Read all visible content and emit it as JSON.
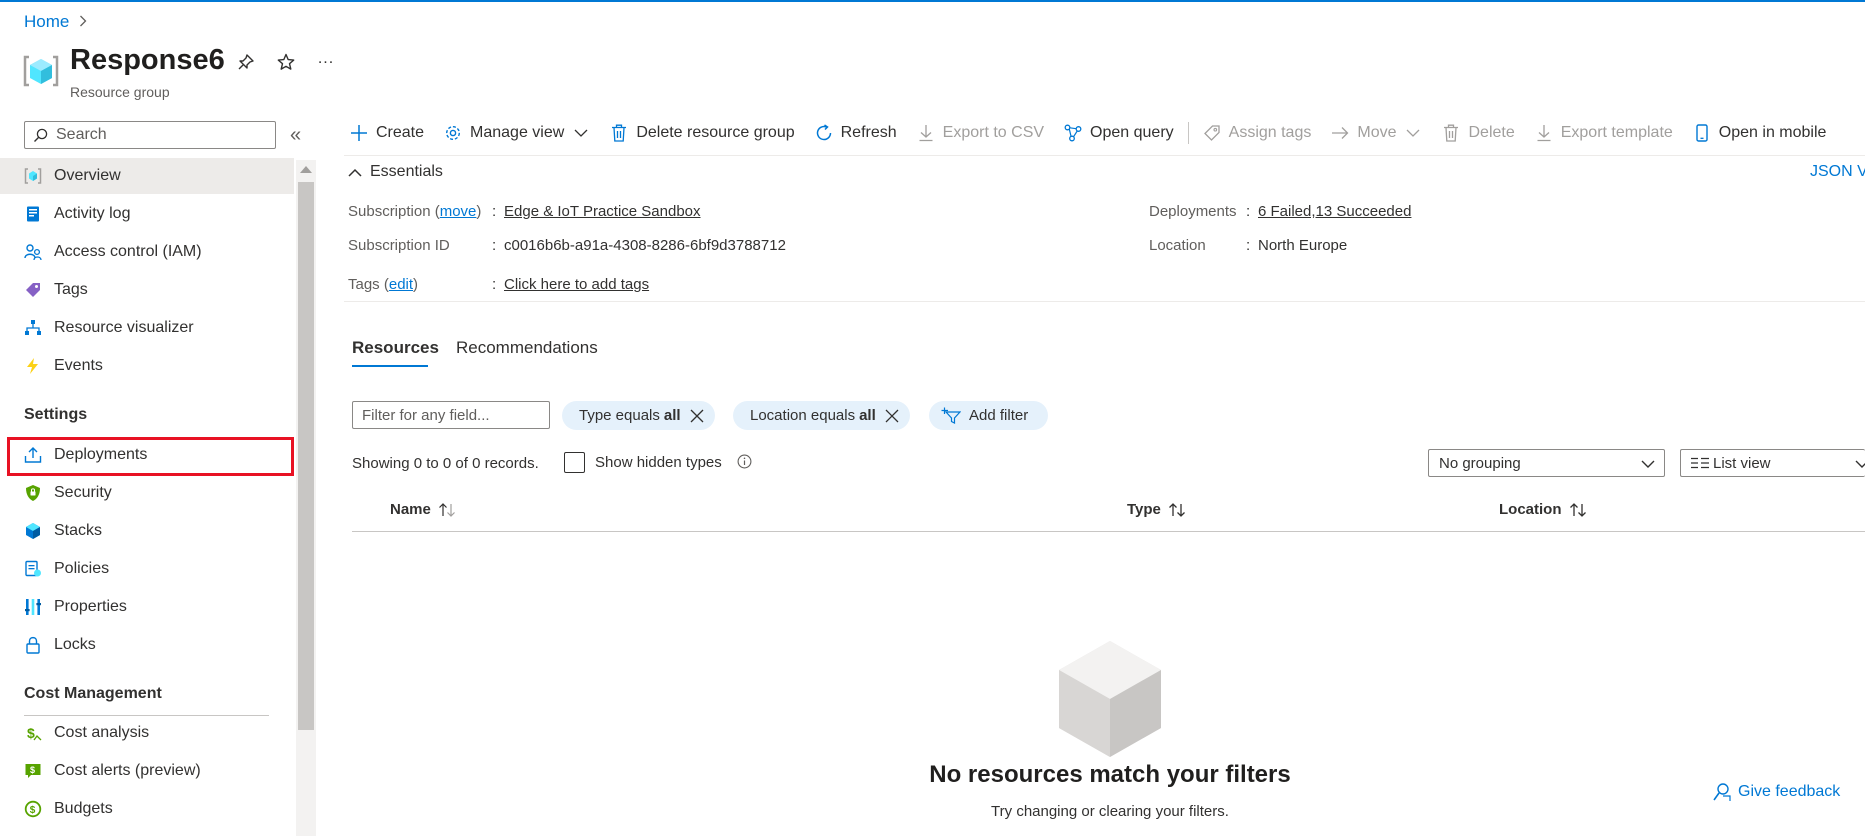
{
  "breadcrumb": {
    "home": "Home"
  },
  "header": {
    "title": "Response6",
    "subtitle": "Resource group",
    "more_label": "..."
  },
  "sidebar": {
    "search_placeholder": "Search",
    "items": [
      {
        "label": "Overview",
        "icon": "overview-icon",
        "selected": true
      },
      {
        "label": "Activity log",
        "icon": "activity-log-icon"
      },
      {
        "label": "Access control (IAM)",
        "icon": "iam-icon"
      },
      {
        "label": "Tags",
        "icon": "tag-icon"
      },
      {
        "label": "Resource visualizer",
        "icon": "visualizer-icon"
      },
      {
        "label": "Events",
        "icon": "lightning-icon"
      }
    ],
    "settings_header": "Settings",
    "settings_items": [
      {
        "label": "Deployments",
        "icon": "upload-icon"
      },
      {
        "label": "Security",
        "icon": "shield-icon"
      },
      {
        "label": "Stacks",
        "icon": "stacks-icon"
      },
      {
        "label": "Policies",
        "icon": "policy-icon"
      },
      {
        "label": "Properties",
        "icon": "properties-icon"
      },
      {
        "label": "Locks",
        "icon": "lock-icon"
      }
    ],
    "cost_header": "Cost Management",
    "cost_items": [
      {
        "label": "Cost analysis",
        "icon": "cost-analysis-icon"
      },
      {
        "label": "Cost alerts (preview)",
        "icon": "cost-alerts-icon"
      },
      {
        "label": "Budgets",
        "icon": "budget-icon"
      }
    ]
  },
  "toolbar": {
    "create": "Create",
    "manage_view": "Manage view",
    "delete_rg": "Delete resource group",
    "refresh": "Refresh",
    "export_csv": "Export to CSV",
    "open_query": "Open query",
    "assign_tags": "Assign tags",
    "move": "Move",
    "delete": "Delete",
    "export_template": "Export template",
    "open_mobile": "Open in mobile"
  },
  "essentials": {
    "header": "Essentials",
    "json_view": "JSON Vi",
    "subscription_label": "Subscription",
    "subscription_move": "move",
    "subscription_value": "Edge & IoT Practice Sandbox",
    "subscription_id_label": "Subscription ID",
    "subscription_id_value": "c0016b6b-a91a-4308-8286-6bf9d3788712",
    "tags_label": "Tags",
    "tags_edit": "edit",
    "tags_value": "Click here to add tags",
    "deployments_label": "Deployments",
    "deployments_value": "6 Failed,13 Succeeded",
    "location_label": "Location",
    "location_value": "North Europe"
  },
  "tabs": {
    "resources": "Resources",
    "recommendations": "Recommendations"
  },
  "filters": {
    "placeholder": "Filter for any field...",
    "type_prefix": "Type equals",
    "type_value": "all",
    "location_prefix": "Location equals",
    "location_value": "all",
    "add_filter": "Add filter"
  },
  "records": {
    "showing": "Showing 0 to 0 of 0 records.",
    "show_hidden": "Show hidden types",
    "grouping": "No grouping",
    "view": "List view"
  },
  "table": {
    "columns": [
      "Name",
      "Type",
      "Location"
    ]
  },
  "empty_state": {
    "title": "No resources match your filters",
    "subtitle": "Try changing or clearing your filters."
  },
  "feedback": "Give feedback",
  "colors": {
    "accent": "#0078d4",
    "highlight": "#e81123",
    "pill_bg": "#e5f1fb",
    "selected_bg": "#edebe9"
  }
}
